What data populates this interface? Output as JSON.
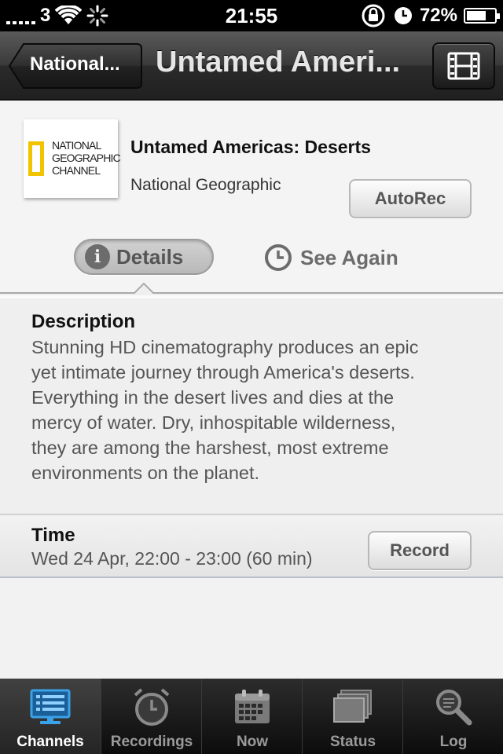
{
  "status_bar": {
    "carrier": "3",
    "time": "21:55",
    "battery_percent_label": "72%",
    "battery_level": 0.72,
    "icons": [
      "signal-icon",
      "wifi-icon",
      "activity-spinner-icon",
      "rotation-lock-icon",
      "alarm-icon",
      "battery-icon"
    ]
  },
  "nav_bar": {
    "back_label": "National...",
    "title": "Untamed Ameri...",
    "right_icon": "film-icon"
  },
  "program": {
    "logo_lines": [
      "NATIONAL",
      "GEOGRAPHIC",
      "CHANNEL"
    ],
    "title": "Untamed Americas: Deserts",
    "channel": "National Geographic",
    "autorec_label": "AutoRec"
  },
  "segmented": {
    "details_label": "Details",
    "see_again_label": "See Again",
    "selected": "Details"
  },
  "description": {
    "heading": "Description",
    "lines": [
      "Stunning HD cinematography produces an epic",
      "yet intimate journey through America's deserts.",
      "Everything in the desert lives and dies at the",
      "mercy of water. Dry, inhospitable wilderness,",
      "they are among the harshest, most extreme",
      "environments on the planet."
    ]
  },
  "time": {
    "heading": "Time",
    "value": "Wed 24 Apr, 22:00 - 23:00 (60 min)",
    "record_label": "Record"
  },
  "tab_bar": {
    "items": [
      {
        "label": "Channels",
        "icon": "channels-icon",
        "active": true
      },
      {
        "label": "Recordings",
        "icon": "alarm-clock-icon",
        "active": false
      },
      {
        "label": "Now",
        "icon": "calendar-icon",
        "active": false
      },
      {
        "label": "Status",
        "icon": "stack-icon",
        "active": false
      },
      {
        "label": "Log",
        "icon": "magnifier-icon",
        "active": false
      }
    ]
  },
  "colors": {
    "accent_blue": "#3aa2e8",
    "navbar": "#2b2b2b",
    "logo_yellow": "#f2c400"
  }
}
